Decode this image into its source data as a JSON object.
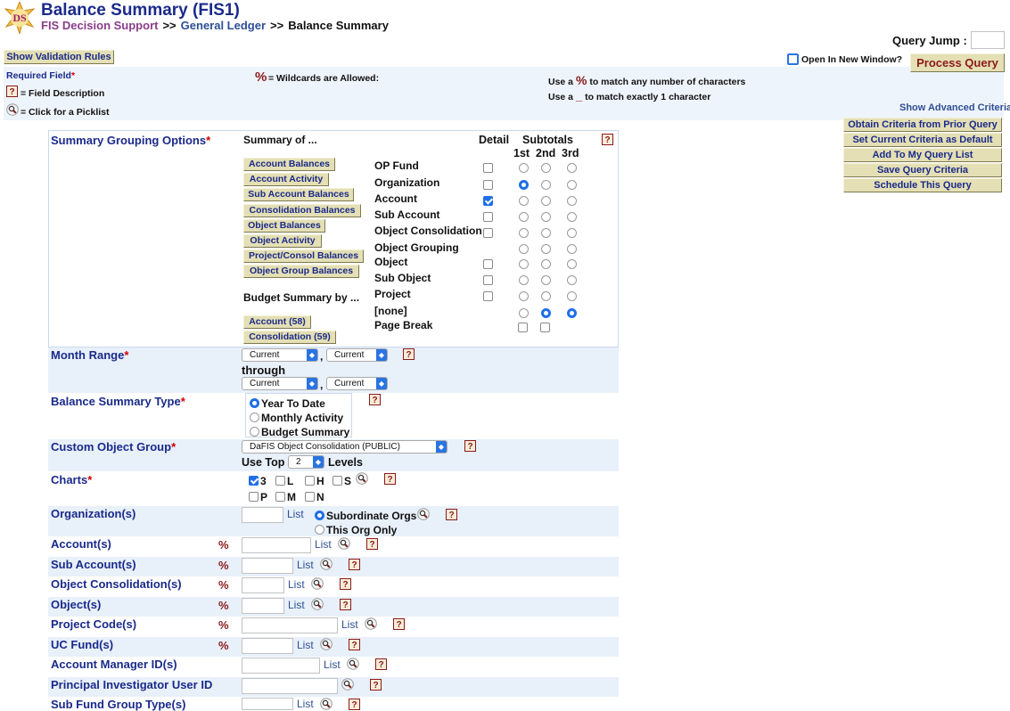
{
  "header": {
    "logo_text": "DS",
    "title": "Balance Summary (FIS1)",
    "breadcrumb": {
      "c1": "FIS Decision Support",
      "c2": "General Ledger",
      "c3": "Balance Summary",
      "sep": ">>"
    },
    "query_jump_label": "Query Jump :",
    "open_new_window_label": "Open In New Window?",
    "process_query": "Process Query",
    "show_validation_rules": "Show Validation Rules"
  },
  "legend": {
    "required_field": "Required Field",
    "wildcard_symbol": "%",
    "wildcards_allowed": "= Wildcards are Allowed:",
    "field_description": "= Field Description",
    "picklist": "= Click for a Picklist",
    "use_a": "Use a",
    "match_any": "to match any number of characters",
    "match_one": "to match exactly 1 character",
    "underscore": "_",
    "show_advanced": "Show Advanced Criteria"
  },
  "side_buttons": [
    "Obtain Criteria from Prior Query",
    "Set Current Criteria as Default",
    "Add To My Query List",
    "Save Query Criteria",
    "Schedule This Query"
  ],
  "grouping": {
    "label": "Summary Grouping Options",
    "summary_of": "Summary of ...",
    "detail": "Detail",
    "subtotals": "Subtotals",
    "sub_cols": [
      "1st",
      "2nd",
      "3rd"
    ],
    "summary_buttons": [
      "Account Balances",
      "Account Activity",
      "Sub Account Balances",
      "Consolidation Balances",
      "Object Balances",
      "Object Activity",
      "Project/Consol Balances",
      "Object Group Balances"
    ],
    "budget_summary_by": "Budget Summary by ...",
    "budget_buttons": [
      "Account (58)",
      "Consolidation (59)"
    ],
    "rows": [
      "OP Fund",
      "Organization",
      "Account",
      "Sub Account",
      "Object Consolidation",
      "Object Grouping",
      "Object",
      "Sub Object",
      "Project",
      "[none]",
      "Page Break"
    ]
  },
  "month_range": {
    "label": "Month Range",
    "from_a": "Current",
    "from_b": "Current",
    "through": "through",
    "to_a": "Current",
    "to_b": "Current"
  },
  "balance_type": {
    "label": "Balance Summary Type",
    "options": [
      "Year To Date",
      "Monthly Activity",
      "Budget Summary"
    ]
  },
  "custom_group": {
    "label": "Custom Object Group",
    "value": "DaFIS Object Consolidation (PUBLIC)",
    "use_top": "Use Top",
    "levels_value": "2",
    "levels": "Levels"
  },
  "charts": {
    "label": "Charts",
    "row1": [
      "3",
      "L",
      "H",
      "S"
    ],
    "row2": [
      "P",
      "M",
      "N"
    ]
  },
  "organizations": {
    "label": "Organization(s)",
    "list": "List",
    "sub_orgs": "Subordinate Orgs",
    "this_org": "This Org Only"
  },
  "fields": [
    {
      "label": "Account(s)",
      "pct": "%",
      "list": "List"
    },
    {
      "label": "Sub Account(s)",
      "pct": "%",
      "list": "List"
    },
    {
      "label": "Object Consolidation(s)",
      "pct": "%",
      "list": "List"
    },
    {
      "label": "Object(s)",
      "pct": "%",
      "list": "List"
    },
    {
      "label": "Project Code(s)",
      "pct": "%",
      "list": "List"
    },
    {
      "label": "UC Fund(s)",
      "pct": "%",
      "list": "List"
    },
    {
      "label": "Account Manager ID(s)",
      "pct": "",
      "list": "List"
    },
    {
      "label": "Principal Investigator User ID",
      "pct": "",
      "list": ""
    },
    {
      "label": "Sub Fund Group Type(s)",
      "pct": "",
      "list": "List"
    }
  ],
  "icons": {
    "help": "?",
    "help_icon": "help-icon",
    "picklist_icon": "magnifier-icon"
  },
  "colors": {
    "title": "#1a2a8a",
    "label": "#1a2a8a",
    "required": "#d10000",
    "band": "#e8f0fa",
    "button": "#e4dfb4",
    "accent": "#1e6fe8"
  }
}
